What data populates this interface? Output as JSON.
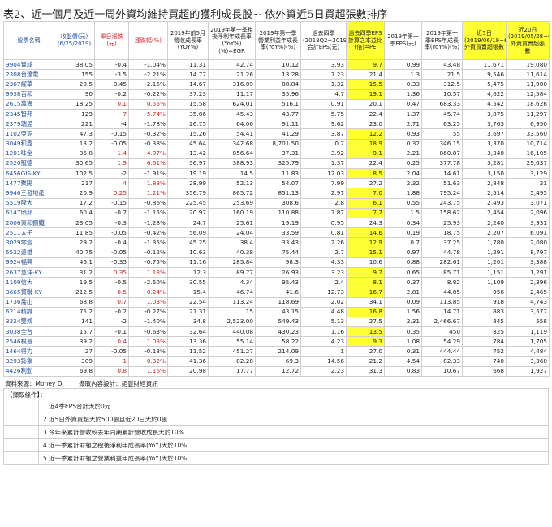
{
  "title": "表2、近一個月及近一周外資均維持買超的獲利成長股~ 依外資近5日買超張數排序",
  "headers": [
    "股票名稱",
    "收盤價(元) (6/25/2019)",
    "單日漲跌 (元)",
    "漲跌幅(%)",
    "2019年前5月營收成長率(YOY%)",
    "2019年第一季稅後淨利年成長率(YoY%)(%)=EGR",
    "2019年第一季營業利益年成長率(YoY%)(%)",
    "過去四季(2018Q2~2019Q1)合計EPS(元)",
    "過去四季EPS計算之本益比(倍)=PE",
    "2019年第一季EPS(元)",
    "2019年第一季EPS年成長率(YoY%)(%)",
    "近5日(2019/06/19~6/25)外資買賣超張數",
    "近20日(2019/05/28~6/25)外資買賣超張數"
  ],
  "rows": [
    [
      "9904寶成",
      "38.05",
      "-0.4",
      "-1.04%",
      "11.31",
      "42.74",
      "10.12",
      "3.93",
      "9.7",
      "0.99",
      "43.48",
      "11,671",
      "19,080"
    ],
    [
      "2308台達電",
      "155",
      "-3.5",
      "-2.21%",
      "14.77",
      "21.26",
      "13.28",
      "7.23",
      "21.4",
      "1.3",
      "21.5",
      "9,546",
      "11,614"
    ],
    [
      "2367燿華",
      "20.5",
      "-0.45",
      "-2.15%",
      "14.67",
      "316.09",
      "88.84",
      "1.32",
      "15.5",
      "0.33",
      "312.5",
      "5,475",
      "11,980"
    ],
    [
      "9938百和",
      "90",
      "-0.2",
      "-0.22%",
      "37.23",
      "11.17",
      "35.96",
      "4.7",
      "19.1",
      "1.36",
      "10.57",
      "4,622",
      "12,584"
    ],
    [
      "2615萬海",
      "18.25",
      "0.1",
      "0.55%",
      "15.58",
      "624.01",
      "516.1",
      "0.91",
      "20.1",
      "0.47",
      "683.33",
      "4,542",
      "18,626"
    ],
    [
      "2345智邦",
      "129",
      "7",
      "5.74%",
      "35.06",
      "45.43",
      "43.77",
      "5.75",
      "22.4",
      "1.37",
      "45.74",
      "3,875",
      "11,297"
    ],
    [
      "2379瑞昱",
      "221",
      "-4",
      "-1.78%",
      "26.75",
      "64.06",
      "91.11",
      "9.62",
      "23.0",
      "2.71",
      "63.25",
      "3,763",
      "6,950"
    ],
    [
      "1102亞泥",
      "47.3",
      "-0.15",
      "-0.32%",
      "15.26",
      "54.41",
      "41.29",
      "3.87",
      "12.2",
      "0.93",
      "55",
      "3,697",
      "33,560"
    ],
    [
      "3049和鑫",
      "13.2",
      "-0.05",
      "-0.38%",
      "45.64",
      "342.68",
      "8,701.50",
      "0.7",
      "18.9",
      "0.32",
      "346.15",
      "3,370",
      "10,714"
    ],
    [
      "1201味全",
      "35.8",
      "1.4",
      "4.07%",
      "13.42",
      "856.64",
      "37.31",
      "3.92",
      "9.1",
      "2.21",
      "860.87",
      "3,340",
      "16,105"
    ],
    [
      "2520冠德",
      "30.65",
      "1.9",
      "6.61%",
      "56.97",
      "388.93",
      "325.79",
      "1.37",
      "22.4",
      "0.25",
      "377.78",
      "3,281",
      "29,637"
    ],
    [
      "6456GIS-KY",
      "102.5",
      "-2",
      "-1.91%",
      "19.19",
      "14.5",
      "11.83",
      "12.03",
      "8.5",
      "2.04",
      "14.61",
      "3,150",
      "3,129"
    ],
    [
      "1477聚陽",
      "217",
      "4",
      "1.88%",
      "28.99",
      "52.13",
      "54.07",
      "7.99",
      "27.2",
      "2.32",
      "51.63",
      "2,848",
      "21"
    ],
    [
      "9946三發地產",
      "20.9",
      "0.25",
      "1.21%",
      "356.79",
      "865.72",
      "851.13",
      "2.97",
      "7.0",
      "1.88",
      "795.24",
      "2,514",
      "5,495"
    ],
    [
      "5519隆大",
      "17.2",
      "-0.15",
      "-0.86%",
      "225.45",
      "253.69",
      "308.6",
      "2.8",
      "6.1",
      "0.55",
      "243.75",
      "2,493",
      "3,071"
    ],
    [
      "6147頎邦",
      "60.4",
      "-0.7",
      "-1.15%",
      "20.97",
      "160.19",
      "110.88",
      "7.87",
      "7.7",
      "1.5",
      "158.62",
      "2,454",
      "2,096"
    ],
    [
      "2006東和鋼鐵",
      "23.05",
      "-0.3",
      "-1.28%",
      "24.7",
      "25.61",
      "19.19",
      "0.95",
      "24.3",
      "0.34",
      "25.93",
      "2,240",
      "3,931"
    ],
    [
      "2511太子",
      "11.85",
      "-0.05",
      "-0.42%",
      "56.09",
      "24.04",
      "33.59",
      "0.81",
      "14.6",
      "0.19",
      "18.75",
      "2,207",
      "6,091"
    ],
    [
      "3029零壹",
      "29.2",
      "-0.4",
      "-1.35%",
      "45.25",
      "38.4",
      "33.43",
      "2.26",
      "12.9",
      "0.7",
      "37.25",
      "1,780",
      "2,080"
    ],
    [
      "5522遠雄",
      "40.75",
      "-0.05",
      "-0.12%",
      "10.63",
      "40.38",
      "75.44",
      "2.7",
      "15.1",
      "0.97",
      "44.78",
      "1,291",
      "8,797"
    ],
    [
      "9924福興",
      "46.1",
      "-0.35",
      "-0.75%",
      "11.16",
      "285.84",
      "98.3",
      "4.33",
      "10.6",
      "0.88",
      "282.61",
      "1,201",
      "3,388"
    ],
    [
      "2637慧洋-KY",
      "31.2",
      "0.35",
      "1.13%",
      "12.3",
      "89.77",
      "26.93",
      "3.23",
      "9.7",
      "0.65",
      "85.71",
      "1,151",
      "1,291"
    ],
    [
      "1109信大",
      "19.5",
      "-0.5",
      "-2.50%",
      "30.55",
      "4.34",
      "95.43",
      "2.4",
      "8.1",
      "0.37",
      "8.82",
      "1,109",
      "2,396"
    ],
    [
      "3665貿聯-KY",
      "212.5",
      "0.5",
      "0.24%",
      "15.4",
      "46.74",
      "41.6",
      "12.73",
      "16.7",
      "2.81",
      "44.85",
      "956",
      "2,465"
    ],
    [
      "1736喬山",
      "68.8",
      "0.7",
      "1.03%",
      "22.54",
      "113.24",
      "118.69",
      "2.02",
      "34.1",
      "0.09",
      "113.85",
      "918",
      "4,743"
    ],
    [
      "6214精誠",
      "75.2",
      "-0.2",
      "-0.27%",
      "21.31",
      "15",
      "43.15",
      "4.48",
      "16.8",
      "1.56",
      "14.71",
      "883",
      "3,577"
    ],
    [
      "3324雙鴻",
      "141",
      "-2",
      "-1.40%",
      "34.8",
      "2,523.00",
      "549.43",
      "5.13",
      "27.5",
      "2.31",
      "2,466.67",
      "845",
      "558"
    ],
    [
      "3038全台",
      "15.7",
      "-0.1",
      "-0.63%",
      "32.64",
      "440.08",
      "430.23",
      "1.16",
      "13.5",
      "0.35",
      "450",
      "825",
      "1,119"
    ],
    [
      "2546根基",
      "39.2",
      "0.4",
      "1.03%",
      "13.36",
      "55.14",
      "58.22",
      "4.23",
      "9.3",
      "1.08",
      "54.29",
      "784",
      "1,705"
    ],
    [
      "1464得力",
      "27",
      "-0.05",
      "-0.18%",
      "11.52",
      "451.27",
      "214.09",
      "1",
      "27.0",
      "0.31",
      "444.44",
      "752",
      "4,484"
    ],
    [
      "3293鈊象",
      "309",
      "1",
      "0.32%",
      "41.36",
      "82.28",
      "69.3",
      "14.56",
      "21.2",
      "4.54",
      "82.33",
      "740",
      "3,360"
    ],
    [
      "4426利勤",
      "69.8",
      "0.8",
      "1.16%",
      "20.98",
      "17.77",
      "12.72",
      "2.23",
      "31.3",
      "0.83",
      "10.67",
      "668",
      "1,927"
    ]
  ],
  "pe_highlight": [
    true,
    false,
    true,
    true,
    false,
    false,
    false,
    true,
    true,
    true,
    false,
    true,
    false,
    true,
    true,
    true,
    false,
    true,
    true,
    true,
    false,
    true,
    true,
    true,
    false,
    true,
    false,
    true,
    true,
    false,
    false,
    false
  ],
  "source": "資料來源：Money DJ",
  "editor": "擷取內容設計：鉅豐財經資訊",
  "conditions_title": "【擷取條件】：",
  "conditions": [
    "1 近4季EPS合計大於0元",
    "2 近5日外資買超大於500張且近20日大於0張",
    "3 今年來累計營收較去年同期累計營收成長大於10%",
    "4 近一季累計財報之稅後淨利年成長率(YoY)大於10%",
    "5 近一季累計財報之營業利益年成長率(YoY)大於10%"
  ],
  "colors": {
    "name_blue": "#1f4e9c",
    "up_red": "#d11f1f",
    "highlight": "#ffff33"
  }
}
